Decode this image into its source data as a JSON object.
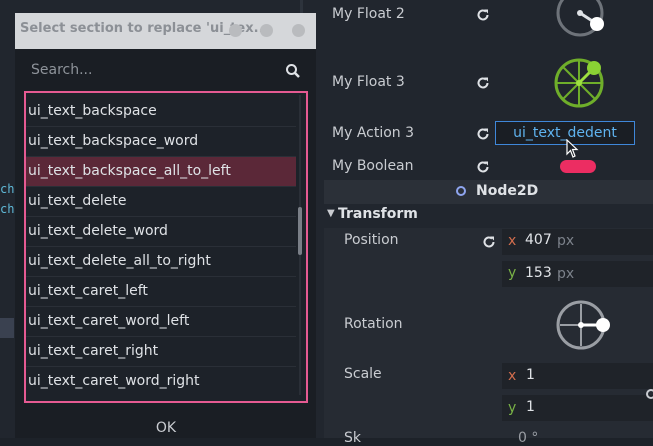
{
  "editor": {
    "code_lines": [
      "ch",
      "ch"
    ]
  },
  "dialog": {
    "title": "Select section to replace 'ui_tex...",
    "search_placeholder": "Search...",
    "items": [
      "ui_text_backspace",
      "ui_text_backspace_word",
      "ui_text_backspace_all_to_left",
      "ui_text_delete",
      "ui_text_delete_word",
      "ui_text_delete_all_to_right",
      "ui_text_caret_left",
      "ui_text_caret_word_left",
      "ui_text_caret_right",
      "ui_text_caret_word_right"
    ],
    "selected_index": 2,
    "ok_label": "OK"
  },
  "inspector": {
    "props": {
      "my_float_2": "My Float 2",
      "my_float_3": "My Float 3",
      "my_action_3": "My Action 3",
      "my_action_3_value": "ui_text_dedent",
      "my_boolean": "My Boolean"
    },
    "node_title": "Node2D",
    "section_title": "Transform",
    "position_label": "Position",
    "position": {
      "x_label": "x",
      "x": "407",
      "y_label": "y",
      "y": "153",
      "unit": "px"
    },
    "rotation_label": "Rotation",
    "scale_label": "Scale",
    "scale": {
      "x_label": "x",
      "x": "1",
      "y_label": "y",
      "y": "1"
    },
    "skew_label": "Sk",
    "skew_value": "0 °"
  },
  "colors": {
    "accent_blue": "#3f87d9",
    "selection_pink": "#e55a92",
    "toggle_on": "#ec2d62",
    "green_knob": "#8ad234",
    "axis_x": "#d16d4d",
    "axis_y": "#79b246"
  }
}
